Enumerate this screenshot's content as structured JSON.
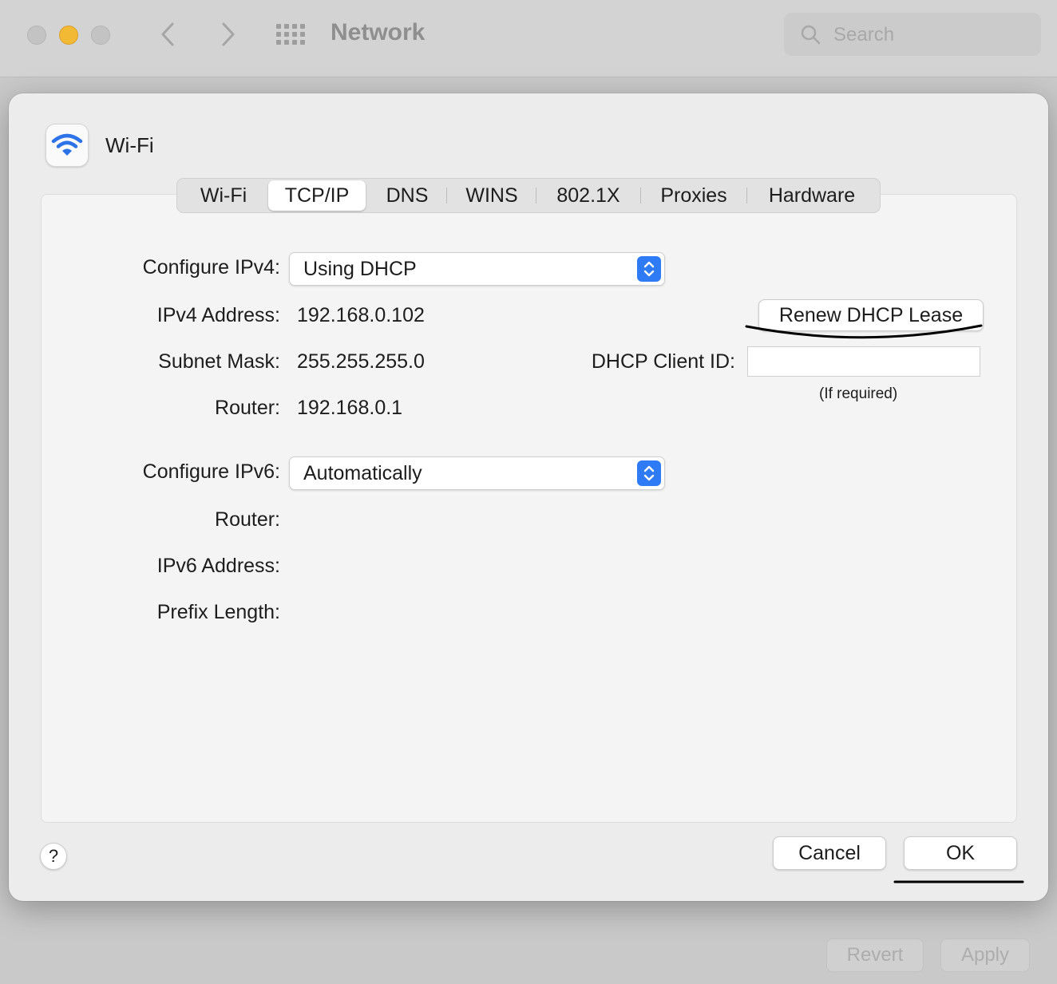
{
  "window": {
    "title": "Network",
    "search_placeholder": "Search",
    "revert_label": "Revert",
    "apply_label": "Apply"
  },
  "sheet": {
    "service_name": "Wi-Fi",
    "tabs": [
      "Wi-Fi",
      "TCP/IP",
      "DNS",
      "WINS",
      "802.1X",
      "Proxies",
      "Hardware"
    ],
    "active_tab": "TCP/IP"
  },
  "ipv4": {
    "configure_label": "Configure IPv4:",
    "configure_value": "Using DHCP",
    "address_label": "IPv4 Address:",
    "address_value": "192.168.0.102",
    "subnet_label": "Subnet Mask:",
    "subnet_value": "255.255.255.0",
    "router_label": "Router:",
    "router_value": "192.168.0.1",
    "renew_label": "Renew DHCP Lease",
    "client_id_label": "DHCP Client ID:",
    "client_id_value": "",
    "client_id_hint": "(If required)"
  },
  "ipv6": {
    "configure_label": "Configure IPv6:",
    "configure_value": "Automatically",
    "router_label": "Router:",
    "address_label": "IPv6 Address:",
    "prefix_label": "Prefix Length:"
  },
  "footer": {
    "help_label": "?",
    "cancel_label": "Cancel",
    "ok_label": "OK"
  },
  "colors": {
    "accent": "#2f7bf5",
    "minimize": "#f2b935"
  }
}
